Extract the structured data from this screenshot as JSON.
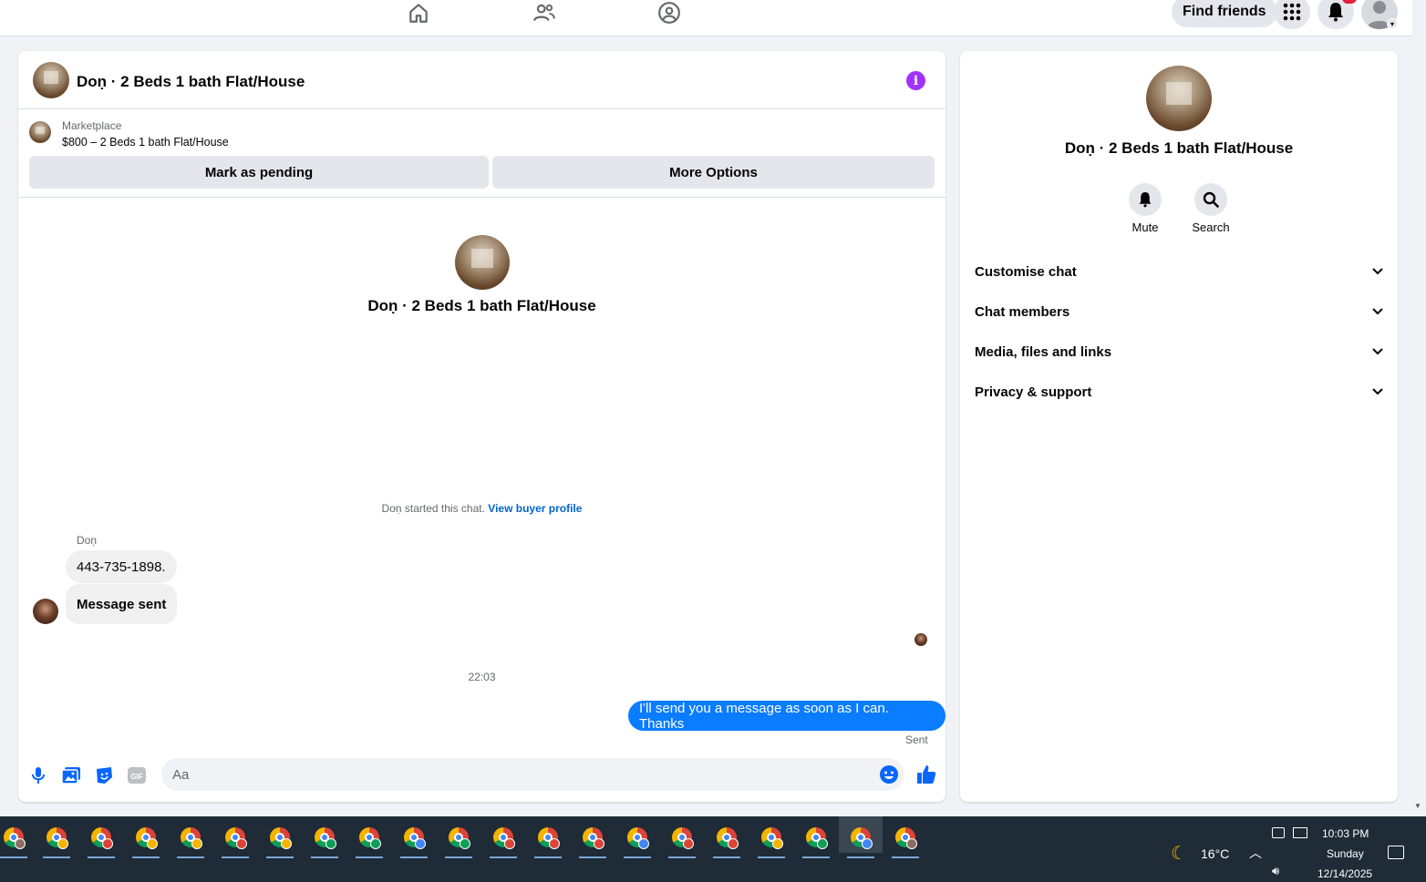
{
  "topbar": {
    "find_friends": "Find friends",
    "notification_badge": ""
  },
  "chat": {
    "title": "Doṇ · 2 Beds 1 bath Flat/House",
    "marketplace_label": "Marketplace",
    "listing": "$800 – 2 Beds 1 bath Flat/House",
    "mark_pending": "Mark as pending",
    "more_options": "More Options",
    "center_title": "Doṇ · 2 Beds 1 bath Flat/House",
    "started_text": "Doṇ started this chat.",
    "view_buyer": "View buyer profile",
    "sender_name": "Doṇ",
    "messages_in": [
      "443-735-1898.",
      "Message sent"
    ],
    "timestamp": "22:03",
    "message_out": "I'll send you a message as soon as I can. Thanks",
    "status": "Sent",
    "input_placeholder": "Aa"
  },
  "info": {
    "title": "Doṇ · 2 Beds 1 bath Flat/House",
    "mute": "Mute",
    "search": "Search",
    "sections": [
      "Customise chat",
      "Chat members",
      "Media, files and links",
      "Privacy & support"
    ]
  },
  "taskbar": {
    "weather": "16°C",
    "time": "10:03 PM",
    "day": "Sunday",
    "date": "12/14/2025"
  },
  "colors": {
    "accent": "#0a7cff",
    "info": "#a033ff",
    "link": "#0064d1"
  }
}
